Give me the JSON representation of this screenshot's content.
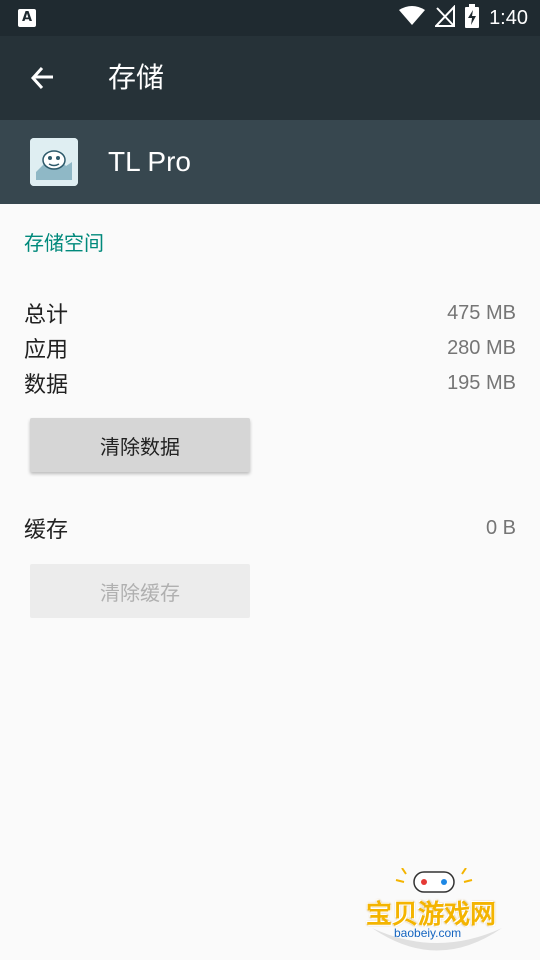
{
  "status_bar": {
    "time": "1:40",
    "notification_icon": "a-letter-icon",
    "icons": [
      "wifi-icon",
      "no-signal-icon",
      "battery-charging-icon"
    ]
  },
  "toolbar": {
    "back_icon": "arrow-left-icon",
    "title": "存储"
  },
  "app": {
    "name": "TL Pro",
    "icon": "app-icon"
  },
  "storage": {
    "section_title": "存储空间",
    "rows": [
      {
        "label": "总计",
        "value": "475 MB"
      },
      {
        "label": "应用",
        "value": "280 MB"
      },
      {
        "label": "数据",
        "value": "195 MB"
      }
    ],
    "clear_data_button": "清除数据"
  },
  "cache": {
    "label": "缓存",
    "value": "0 B",
    "clear_cache_button": "清除缓存"
  },
  "watermark": {
    "text": "宝贝游戏网",
    "url": "baobeiy.com"
  },
  "colors": {
    "status_bar": "#1f2a30",
    "toolbar": "#263238",
    "app_header": "#37474f",
    "accent": "#00897b",
    "background": "#fafafa"
  }
}
